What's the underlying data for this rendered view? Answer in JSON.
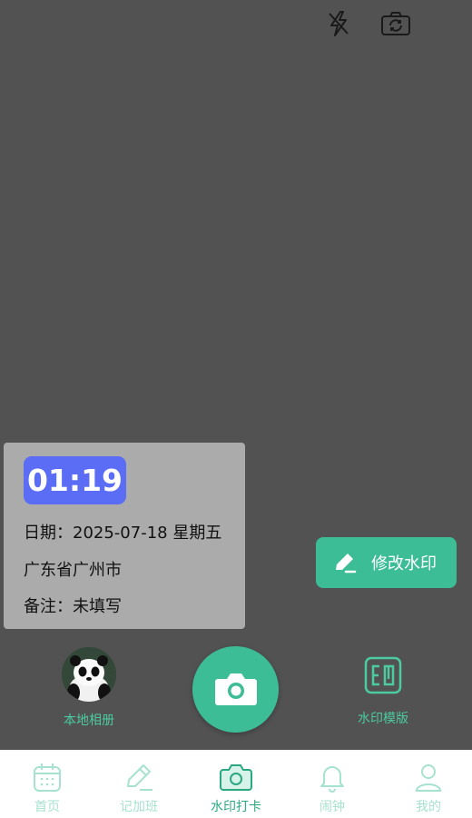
{
  "camera": {
    "flash_icon": "flash-off-icon",
    "switch_icon": "camera-switch-icon"
  },
  "watermark": {
    "time": "01:19",
    "date_label": "日期：",
    "date_value": "2025-07-18 星期五",
    "location": "广东省广州市",
    "note_label": "备注：",
    "note_value": "未填写"
  },
  "actions": {
    "edit_watermark": "修改水印",
    "local_album": "本地相册",
    "watermark_template": "水印模版"
  },
  "tabs": [
    {
      "label": "首页",
      "icon": "calendar-icon"
    },
    {
      "label": "记加班",
      "icon": "pencil-icon"
    },
    {
      "label": "水印打卡",
      "icon": "camera-icon",
      "active": true
    },
    {
      "label": "闹钟",
      "icon": "bell-icon"
    },
    {
      "label": "我的",
      "icon": "user-icon"
    }
  ],
  "colors": {
    "accent": "#3dbd96",
    "time_badge": "#5b6cf5",
    "viewfinder": "#525252",
    "tab_inactive": "#a7e2d0",
    "tab_active": "#2aa882"
  }
}
